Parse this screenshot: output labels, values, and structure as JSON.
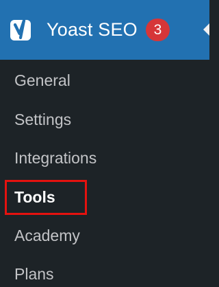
{
  "menu": {
    "title": "Yoast SEO",
    "badge_count": "3",
    "logo_icon": "yoast-logo-icon",
    "colors": {
      "header_bg": "#2271b1",
      "sidebar_bg": "#1d2327",
      "badge_bg": "#d63638",
      "highlight": "#e5120f"
    },
    "items": [
      {
        "label": "General",
        "active": false
      },
      {
        "label": "Settings",
        "active": false
      },
      {
        "label": "Integrations",
        "active": false
      },
      {
        "label": "Tools",
        "active": true,
        "highlighted": true
      },
      {
        "label": "Academy",
        "active": false
      },
      {
        "label": "Plans",
        "active": false
      }
    ]
  }
}
